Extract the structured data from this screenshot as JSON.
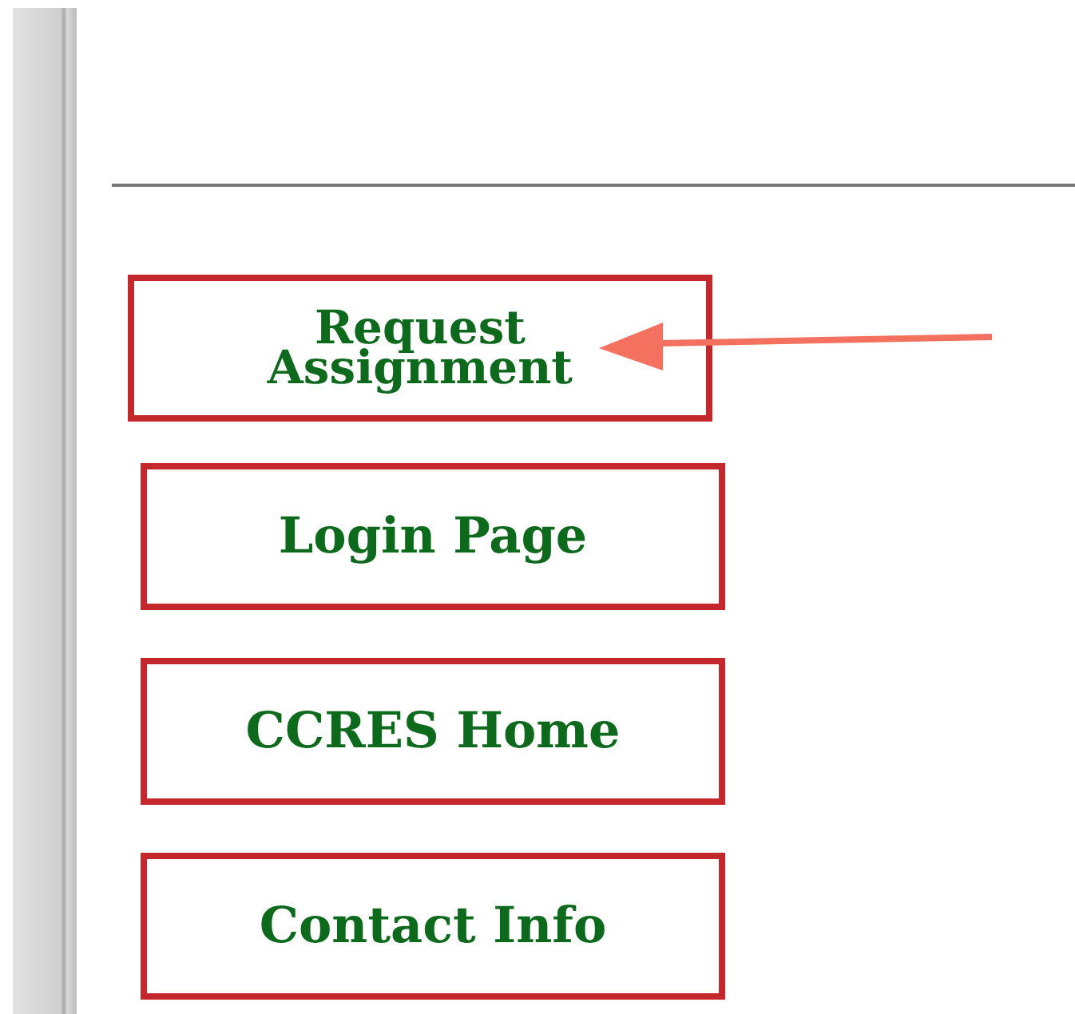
{
  "nav_buttons": [
    {
      "label": "Request Assignment",
      "highlighted": true
    },
    {
      "label": "Login Page",
      "highlighted": false
    },
    {
      "label": "CCRES Home",
      "highlighted": false
    },
    {
      "label": "Contact Info",
      "highlighted": false
    }
  ]
}
